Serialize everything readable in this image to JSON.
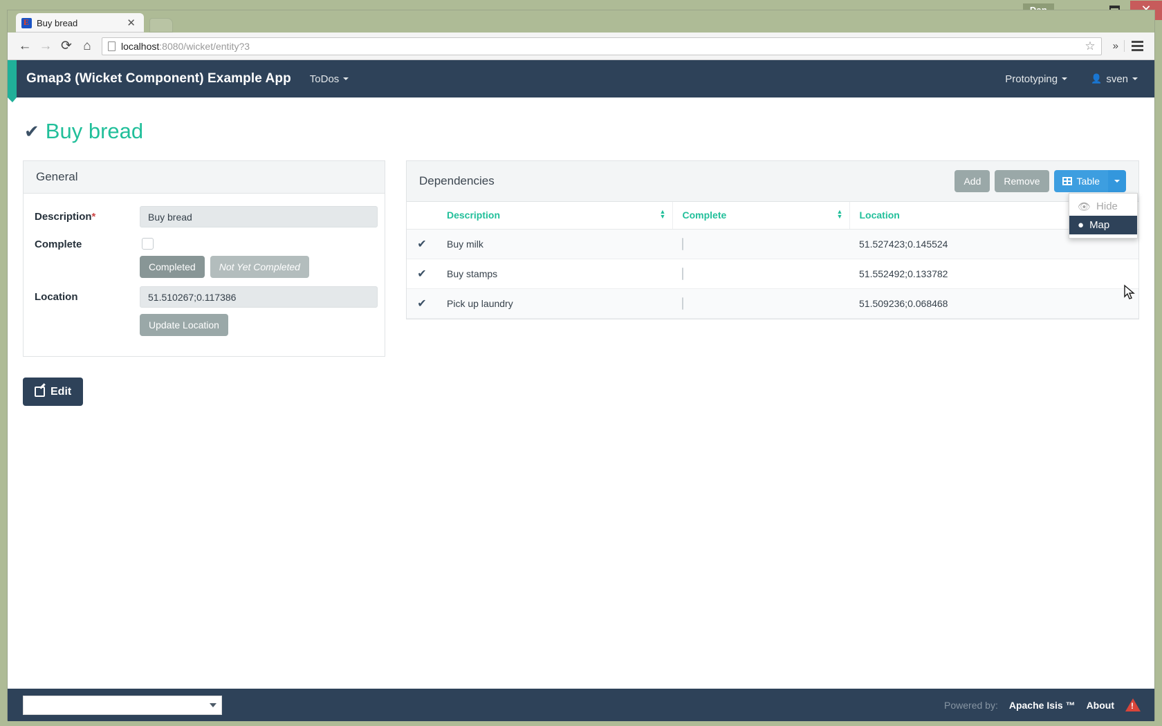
{
  "os": {
    "profile_name": "Dan",
    "minimize_label": "Minimize",
    "maximize_label": "Maximize",
    "close_label": "✕"
  },
  "browser": {
    "tab": {
      "title": "Buy bread",
      "close_label": "✕",
      "favicon": "wicket-favicon"
    },
    "new_tab_label": "",
    "toolbar": {
      "back_label": "←",
      "forward_label": "→",
      "reload_label": "⟳",
      "home_label": "⌂",
      "url_host": "localhost",
      "url_rest": ":8080/wicket/entity?3",
      "bookmark_label": "☆",
      "overflow_label": "»"
    }
  },
  "navbar": {
    "brand": "Gmap3 (Wicket Component) Example App",
    "menu": {
      "todos": "ToDos"
    },
    "right": {
      "prototyping": "Prototyping",
      "user": "sven"
    }
  },
  "page": {
    "title": "Buy bread",
    "title_icon": "check-icon"
  },
  "general": {
    "heading": "General",
    "description": {
      "label": "Description",
      "required_marker": "*",
      "value": "Buy bread"
    },
    "complete": {
      "label": "Complete",
      "checked": false,
      "completed_button": "Completed",
      "not_completed_button": "Not Yet Completed"
    },
    "location": {
      "label": "Location",
      "value": "51.510267;0.117386",
      "update_button": "Update Location"
    },
    "edit_button": "Edit"
  },
  "dependencies": {
    "heading": "Dependencies",
    "actions": {
      "add": "Add",
      "remove": "Remove",
      "view": "Table"
    },
    "view_menu": [
      {
        "label": "Hide",
        "icon": "eye-slash-icon",
        "state": "disabled"
      },
      {
        "label": "Map",
        "icon": "map-pin-icon",
        "state": "active"
      }
    ],
    "columns": [
      "",
      "Description",
      "Complete",
      "Location"
    ],
    "rows": [
      {
        "select_icon": "check-icon",
        "description": "Buy milk",
        "complete": false,
        "location": "51.527423;0.145524"
      },
      {
        "select_icon": "check-icon",
        "description": "Buy stamps",
        "complete": false,
        "location": "51.552492;0.133782"
      },
      {
        "select_icon": "check-icon",
        "description": "Pick up laundry",
        "complete": false,
        "location": "51.509236;0.068468"
      }
    ]
  },
  "footer": {
    "select_value": "",
    "powered_by": "Powered by:",
    "product": "Apache Isis ™",
    "about": "About",
    "warning_icon": "warning-triangle-icon"
  },
  "colors": {
    "navy": "#2e4259",
    "teal": "#21bf9a",
    "blue": "#3d9ee0",
    "gray_button": "#9aa8a8",
    "desktop": "#aebb96",
    "danger": "#d9453a"
  }
}
